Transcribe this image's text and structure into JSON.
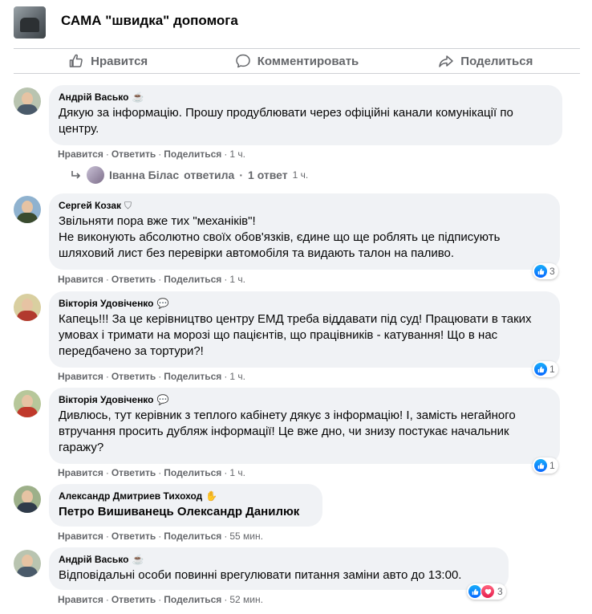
{
  "group": {
    "title": "САМА \"швидка\" допомога",
    "avatar_icon": "group-avatar"
  },
  "actions": {
    "like": "Нравится",
    "comment": "Комментировать",
    "share": "Поделиться"
  },
  "comment_links": {
    "like": "Нравится",
    "reply": "Ответить",
    "share": "Поделиться"
  },
  "comments": [
    {
      "author": "Андрій Васько",
      "badge_icon": "coffee-cup-icon",
      "text": "Дякую за інформацію. Прошу продублювати через офіційні канали комунікації по центру.",
      "time": "1 ч."
    },
    {
      "author": "Сергей Козак",
      "badge_icon": "shield-badge-icon",
      "text": "Звільняти пора вже тих \"механіків\"!",
      "text2": "Не виконують абсолютно своїх обов'язків, єдине що ще роблять це підписують шляховий лист без перевірки автомобіля та видають талон на паливо.",
      "time": "1 ч.",
      "reactions": "3"
    },
    {
      "author": "Вікторія Удовіченко",
      "badge_icon": "chat-bubble-icon",
      "text": "Капець!!! За це керівництво центру ЕМД треба віддавати під суд! Працювати в таких умовах і тримати на морозі що пацієнтів, що працівників - катування! Що в нас передбачено за тортури?!",
      "time": "1 ч.",
      "reactions": "1"
    },
    {
      "author": "Вікторія Удовіченко",
      "badge_icon": "chat-bubble-icon",
      "text": "Дивлюсь, тут керівник з теплого кабінету дякує з інформацію! І, замість негайного втручання просить дубляж інформації! Це вже дно, чи знизу постукає начальник гаражу?",
      "time": "1 ч.",
      "reactions": "1"
    },
    {
      "author": "Александр Дмитриев Тихоход",
      "badge_icon": "waving-hand-icon",
      "text": "Петро Вишиванець Олександр Данилюк",
      "time": "55 мин."
    },
    {
      "author": "Андрій Васько",
      "badge_icon": "coffee-cup-icon",
      "text": "Відповідальні особи повинні врегулювати питання заміни авто до 13:00.",
      "time": "52 мин.",
      "reactions": "3"
    }
  ],
  "reply": {
    "name": "Іванна Білас",
    "verb": "ответила",
    "dot": "·",
    "count": "1 ответ",
    "time": "1 ч."
  },
  "colors": {
    "bubble": "#f0f2f5",
    "secondary_text": "#65676b",
    "like_blue": "#0866ff",
    "love_red": "#e61e4d"
  }
}
